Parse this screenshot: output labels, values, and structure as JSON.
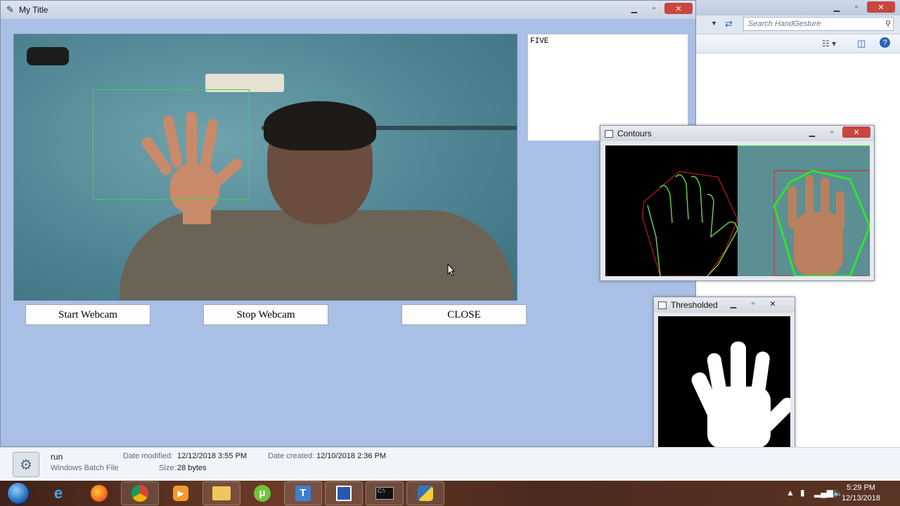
{
  "main_window": {
    "title": "My Title",
    "textbox_value": "FIVE",
    "buttons": {
      "start": "Start Webcam",
      "stop": "Stop Webcam",
      "close": "CLOSE"
    }
  },
  "window_controls": {
    "minimize": "▁",
    "maximize": "▫",
    "close": "✕"
  },
  "explorer": {
    "search_placeholder": "Search HandGesture"
  },
  "contours_window": {
    "title": "Contours"
  },
  "thresholded_window": {
    "title": "Thresholded"
  },
  "details_pane": {
    "file_name": "run",
    "file_type": "Windows Batch File",
    "date_modified_label": "Date modified:",
    "date_modified": "12/12/2018 3:55 PM",
    "date_created_label": "Date created:",
    "date_created": "12/10/2018 2:36 PM",
    "size_label": "Size:",
    "size": "28 bytes"
  },
  "taskbar": {
    "time": "5:29 PM",
    "date": "12/13/2018",
    "apps": [
      "windows-explorer-ie",
      "firefox",
      "chrome",
      "media-player",
      "file-explorer",
      "utorrent",
      "typing-app",
      "python-idle",
      "cmd",
      "python"
    ]
  },
  "colors": {
    "window_bg": "#aabfe6",
    "roi_green": "#3dd63d",
    "contour_red": "#e02020",
    "hull_green": "#2fe32f"
  }
}
